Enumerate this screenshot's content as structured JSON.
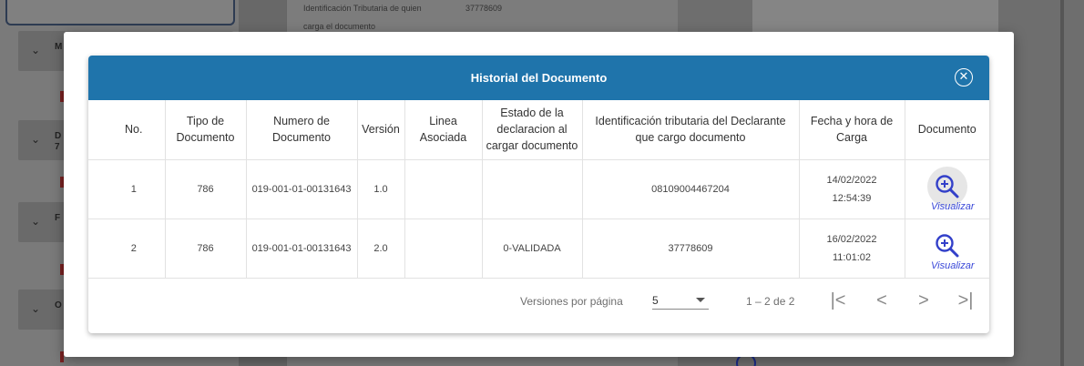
{
  "background": {
    "sidebar_letters": [
      "M",
      "D\n7",
      "F",
      "O"
    ],
    "main_text": {
      "line1": "Identificación Tributaria de quien",
      "line2": "carga el documento",
      "value": "37778609"
    }
  },
  "modal": {
    "title": "Historial del Documento",
    "close_icon": "⊗",
    "columns": [
      "No.",
      "Tipo de Documento",
      "Numero de Documento",
      "Versión",
      "Linea Asociada",
      "Estado de la declaracion al cargar documento",
      "Identificación tributaria del Declarante que cargo documento",
      "Fecha y hora de Carga",
      "Documento"
    ],
    "rows": [
      {
        "no": "1",
        "tipo": "786",
        "numero": "019-001-01-00131643",
        "version": "1.0",
        "linea": "",
        "estado": "",
        "identificacion": "08109004467204",
        "fecha": "14/02/2022",
        "hora": "12:54:39",
        "accion": "Visualizar"
      },
      {
        "no": "2",
        "tipo": "786",
        "numero": "019-001-01-00131643",
        "version": "2.0",
        "linea": "",
        "estado": "0-VALIDADA",
        "identificacion": "37778609",
        "fecha": "16/02/2022",
        "hora": "11:01:02",
        "accion": "Visualizar"
      }
    ],
    "paginator": {
      "label": "Versiones por página",
      "page_size": "5",
      "range": "1 – 2 de 2",
      "first_icon": "|<",
      "prev_icon": "<",
      "next_icon": ">",
      "last_icon": ">|"
    }
  },
  "colors": {
    "header_bg": "#1f74ab",
    "link": "#3a48d8",
    "zoom_icon": "#3340c9"
  }
}
